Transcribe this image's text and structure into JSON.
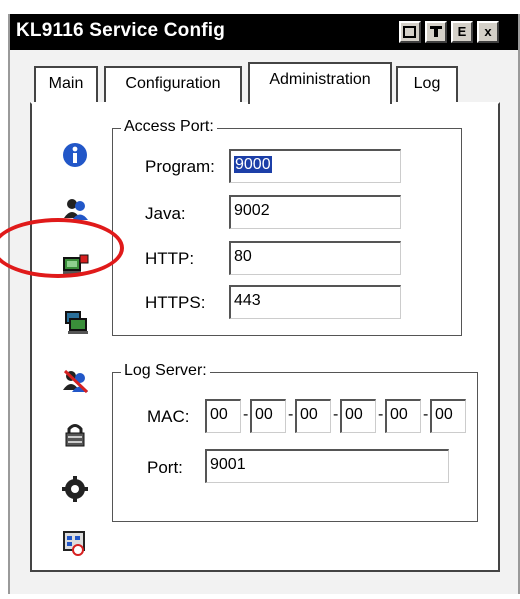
{
  "window": {
    "title": "KL9116 Service Config"
  },
  "title_buttons": [
    "",
    "",
    "E",
    "x"
  ],
  "tabs": [
    {
      "label": "Main"
    },
    {
      "label": "Configuration"
    },
    {
      "label": "Administration"
    },
    {
      "label": "Log"
    }
  ],
  "active_tab": "Administration",
  "sidebar_icons": [
    "info-icon",
    "users-icon",
    "network-computer-icon",
    "computer-icon",
    "user-remove-icon",
    "lock-icon",
    "gear-icon",
    "calendar-alarm-icon"
  ],
  "access_port": {
    "legend": "Access Port:",
    "program": {
      "label": "Program:",
      "value": "9000"
    },
    "java": {
      "label": "Java:",
      "value": "9002"
    },
    "http": {
      "label": "HTTP:",
      "value": "80"
    },
    "https": {
      "label": "HTTPS:",
      "value": "443"
    }
  },
  "log_server": {
    "legend": "Log Server:",
    "mac": {
      "label": "MAC:",
      "values": [
        "00",
        "00",
        "00",
        "00",
        "00",
        "00"
      ],
      "separator": "-"
    },
    "port": {
      "label": "Port:",
      "value": "9001"
    }
  },
  "colors": {
    "highlight": "#e01a1a",
    "selection": "#1c3fa8",
    "titlebar": "#000000"
  }
}
